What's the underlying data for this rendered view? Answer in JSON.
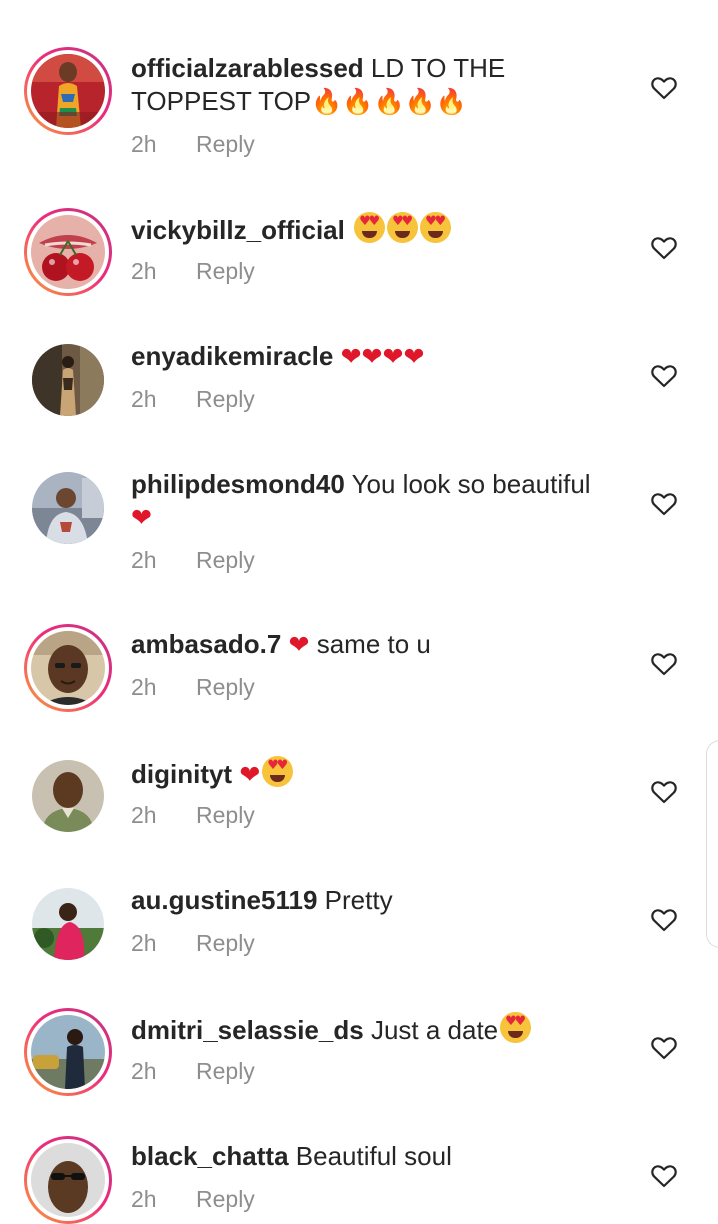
{
  "comments": [
    {
      "username": "officialzarablessed",
      "text_line1": "LD TO THE",
      "text_line2": "TOPPEST  TOP",
      "emojis": [
        "🔥",
        "🔥",
        "🔥",
        "🔥",
        "🔥"
      ],
      "time": "2h",
      "reply_label": "Reply",
      "story_ring": true
    },
    {
      "username": "vickybillz_official",
      "text": "",
      "emojis": [
        "😍",
        "😍",
        "😍"
      ],
      "time": "2h",
      "reply_label": "Reply",
      "story_ring": true
    },
    {
      "username": "enyadikemiracle",
      "text": "",
      "emojis": [
        "❤",
        "❤",
        "❤",
        "❤"
      ],
      "time": "2h",
      "reply_label": "Reply",
      "story_ring": false
    },
    {
      "username": "philipdesmond40",
      "text": "You look so beautiful",
      "emojis": [
        "❤"
      ],
      "time": "2h",
      "reply_label": "Reply",
      "story_ring": false
    },
    {
      "username": "ambasado.7",
      "emoji_before": "❤",
      "text": "same to u",
      "time": "2h",
      "reply_label": "Reply",
      "story_ring": true
    },
    {
      "username": "diginityt",
      "text": "",
      "emojis": [
        "❤",
        "😍"
      ],
      "time": "2h",
      "reply_label": "Reply",
      "story_ring": false
    },
    {
      "username": "au.gustine5119",
      "text": "Pretty",
      "time": "2h",
      "reply_label": "Reply",
      "story_ring": false
    },
    {
      "username": "dmitri_selassie_ds",
      "text": "Just a date",
      "emojis": [
        "😍"
      ],
      "time": "2h",
      "reply_label": "Reply",
      "story_ring": true
    },
    {
      "username": "black_chatta",
      "text": "Beautiful soul",
      "time": "2h",
      "reply_label": "Reply",
      "story_ring": true
    }
  ],
  "icons": {
    "like": "heart-outline-icon"
  },
  "colors": {
    "text_primary": "#262626",
    "text_secondary": "#8e8e8e",
    "heart_emoji": "#e0172a",
    "story_ring_start": "#f9a23a",
    "story_ring_end": "#c13584"
  }
}
